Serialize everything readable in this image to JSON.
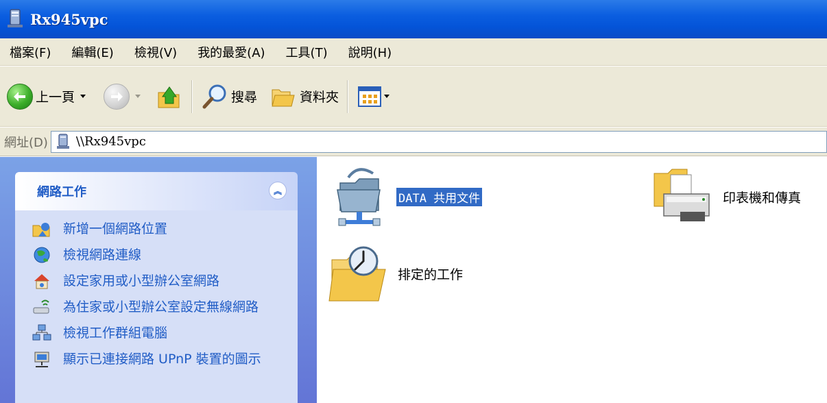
{
  "window": {
    "title": "Rx945vpc"
  },
  "menu": [
    "檔案(F)",
    "編輯(E)",
    "檢視(V)",
    "我的最愛(A)",
    "工具(T)",
    "說明(H)"
  ],
  "toolbar": {
    "back_label": "上一頁",
    "search_label": "搜尋",
    "folders_label": "資料夾"
  },
  "address": {
    "label": "網址(D)",
    "value": "\\\\Rx945vpc"
  },
  "tasks": {
    "title": "網路工作",
    "items": [
      "新增一個網路位置",
      "檢視網路連線",
      "設定家用或小型辦公室網路",
      "為住家或小型辦公室設定無線網路",
      "檢視工作群組電腦",
      "顯示已連接網路 UPnP 裝置的圖示"
    ]
  },
  "items": {
    "data_share": "DATA 共用文件",
    "printers": "印表機和傳真",
    "scheduled": "排定的工作"
  },
  "colors": {
    "titlebar": "#0454d8",
    "task_link": "#215dc6",
    "selection": "#316ac5",
    "panel_bg": "#7ba2e7"
  }
}
